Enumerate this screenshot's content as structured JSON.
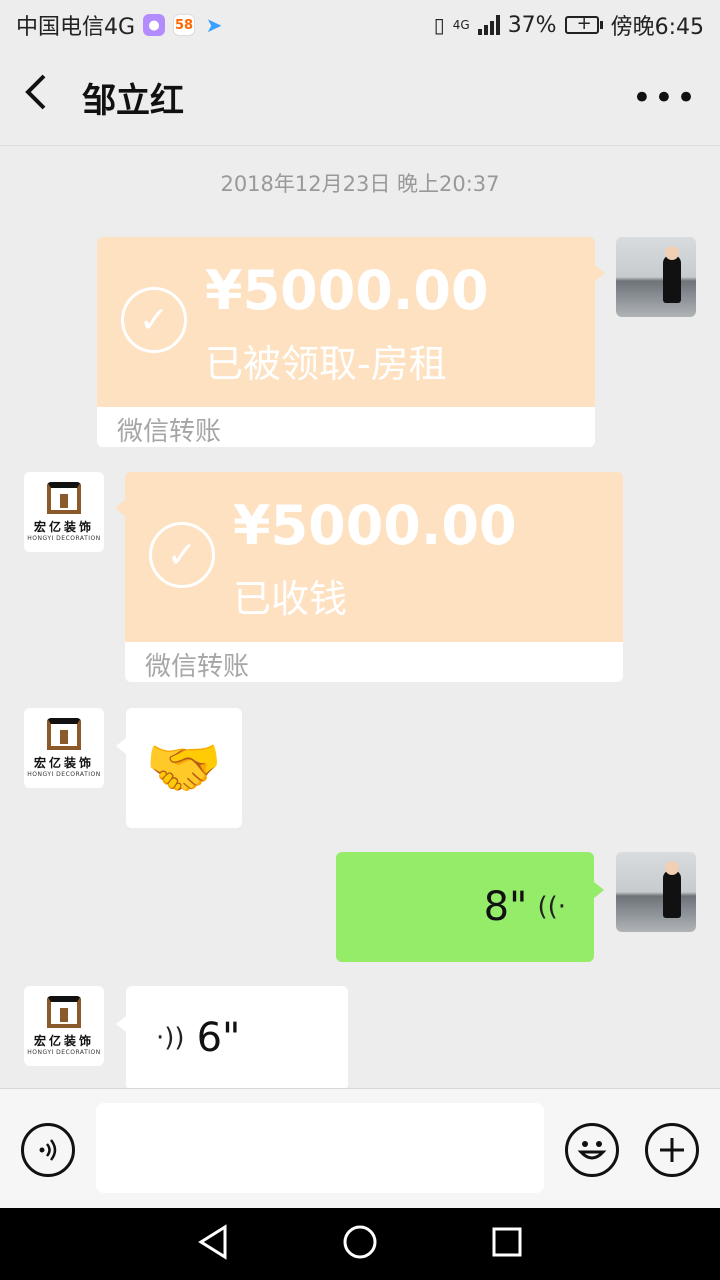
{
  "status_bar": {
    "carrier": "中国电信4G",
    "app_58": "58",
    "network_label": "4G",
    "battery": "37%",
    "time": "傍晚6:45"
  },
  "header": {
    "title": "邹立红",
    "more_label": "•••"
  },
  "chat": {
    "timestamp": "2018年12月23日 晚上20:37",
    "messages": [
      {
        "type": "transfer",
        "side": "right",
        "amount": "¥5000.00",
        "status": "已被领取-房租",
        "footer": "微信转账"
      },
      {
        "type": "transfer",
        "side": "left",
        "amount": "¥5000.00",
        "status": "已收钱",
        "footer": "微信转账"
      },
      {
        "type": "emoji",
        "side": "left",
        "content": "🤝"
      },
      {
        "type": "voice",
        "side": "right",
        "duration": "8\""
      },
      {
        "type": "voice",
        "side": "left",
        "duration": "6\""
      }
    ]
  },
  "contact_avatar": {
    "logo_text": "宏亿装饰",
    "logo_sub": "HONGYI DECORATION"
  },
  "input_bar": {
    "placeholder": ""
  },
  "colors": {
    "transfer_bg": "#fde1c1",
    "voice_out_bg": "#95ec69",
    "chat_bg": "#ededed"
  }
}
